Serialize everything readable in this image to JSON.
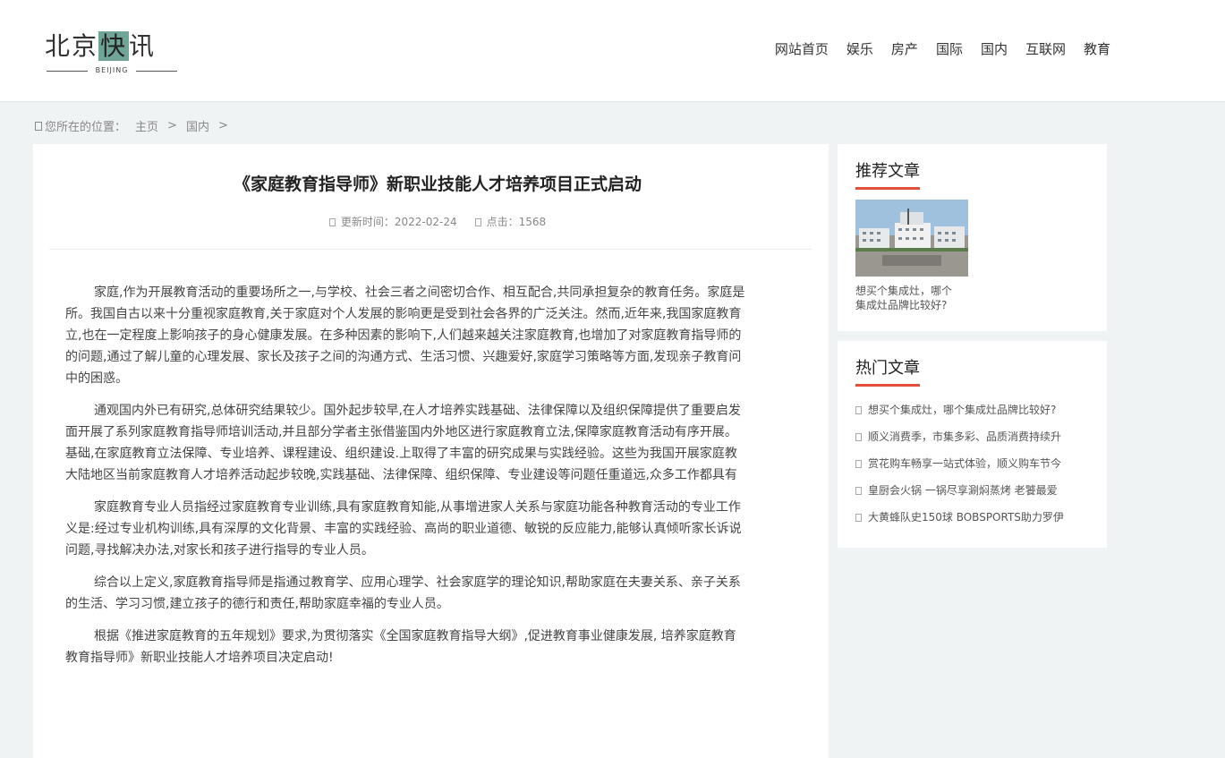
{
  "header": {
    "logo": {
      "cn_part1": "北京",
      "cn_highlight": "快",
      "cn_part3": "讯",
      "en": "BEIJING"
    },
    "nav": [
      "网站首页",
      "娱乐",
      "房产",
      "国际",
      "国内",
      "互联网",
      "教育"
    ]
  },
  "breadcrumb": {
    "prefix": "您所在的位置：",
    "items": [
      "主页",
      "国内"
    ],
    "sep": ">"
  },
  "article": {
    "title": "《家庭教育指导师》新职业技能人才培养项目正式启动",
    "updated_label": "更新时间：2022-02-24",
    "clicks_label": "点击：1568",
    "paragraphs": [
      "家庭,作为开展教育活动的重要场所之一,与学校、社会三者之间密切合作、相互配合,共同承担复杂的教育任务。家庭是",
      "所。我国自古以来十分重视家庭教育,关于家庭对个人发展的影响更是受到社会各界的广泛关注。然而,近年来,我国家庭教育",
      "立,也在一定程度上影响孩子的身心健康发展。在多种因素的影响下,人们越来越关注家庭教育,也增加了对家庭教育指导师的",
      "的问题,通过了解儿童的心理发展、家长及孩子之间的沟通方式、生活习惯、兴趣爱好,家庭学习策略等方面,发现亲子教育问",
      "中的困惑。",
      "通观国内外已有研究,总体研究结果较少。国外起步较早,在人才培养实践基础、法律保障以及组织保障提供了重要启发",
      "面开展了系列家庭教育指导师培训活动,并且部分学者主张借鉴国内外地区进行家庭教育立法,保障家庭教育活动有序开展。",
      "基础,在家庭教育立法保障、专业培养、课程建设、组织建设.上取得了丰富的研究成果与实践经验。这些为我国开展家庭教",
      "大陆地区当前家庭教育人才培养活动起步较晚,实践基础、法律保障、组织保障、专业建设等问题任重道远,众多工作都具有",
      "家庭教育专业人员指经过家庭教育专业训练,具有家庭教育知能,从事增进家人关系与家庭功能各种教育活动的专业工作",
      "义是:经过专业机构训练,具有深厚的文化背景、丰富的实践经验、高尚的职业道德、敏锐的反应能力,能够认真倾听家长诉说",
      "问题,寻找解决办法,对家长和孩子进行指导的专业人员。",
      "综合以上定义,家庭教育指导师是指通过教育学、应用心理学、社会家庭学的理论知识,帮助家庭在夫妻关系、亲子关系",
      "的生活、学习习惯,建立孩子的德行和责任,帮助家庭幸福的专业人员。",
      "根据《推进家庭教育的五年规划》要求,为贯彻落实《全国家庭教育指导大纲》,促进教育事业健康发展, 培养家庭教育",
      "教育指导师》新职业技能人才培养项目决定启动!"
    ]
  },
  "sidebar": {
    "recommended": {
      "heading": "推荐文章",
      "caption_line1": "想买个集成灶，哪个",
      "caption_line2": "集成灶品牌比较好?"
    },
    "hot": {
      "heading": "热门文章",
      "items": [
        "想买个集成灶，哪个集成灶品牌比较好?",
        "顺义消费季，市集多彩、品质消费持续升",
        "赏花购车畅享一站式体验，顺义购车节今",
        "皇厨会火锅 一锅尽享涮焖蒸烤 老饕最爱",
        "大黄蜂队史150球 BOBSPORTS助力罗伊"
      ]
    }
  },
  "colors": {
    "accent": "#e0503c",
    "logo_highlight": "#6ea597",
    "page_bg": "#f0f3f4"
  }
}
